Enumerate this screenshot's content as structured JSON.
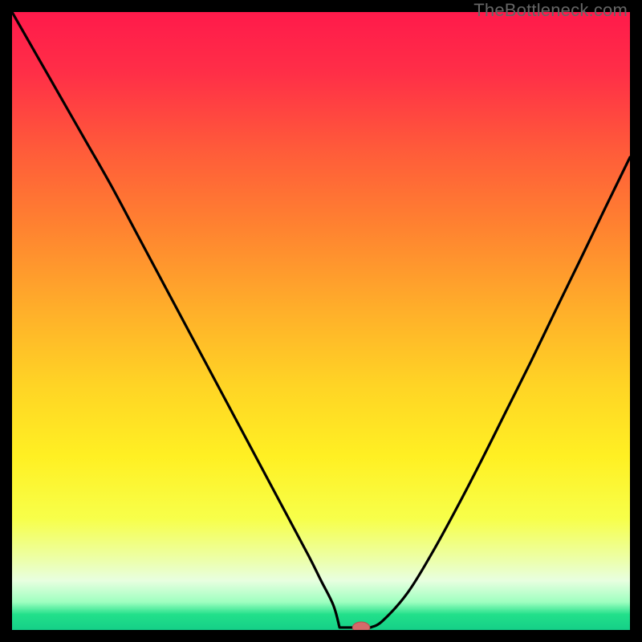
{
  "watermark": "TheBottleneck.com",
  "colors": {
    "frame": "#000000",
    "curve": "#000000",
    "marker_fill": "#d46a6a",
    "marker_stroke": "#b74f4f",
    "gradient_stops": [
      {
        "offset": 0.0,
        "color": "#ff1a4b"
      },
      {
        "offset": 0.1,
        "color": "#ff2f47"
      },
      {
        "offset": 0.22,
        "color": "#ff5a3a"
      },
      {
        "offset": 0.35,
        "color": "#ff8330"
      },
      {
        "offset": 0.48,
        "color": "#ffae2a"
      },
      {
        "offset": 0.6,
        "color": "#ffd325"
      },
      {
        "offset": 0.72,
        "color": "#fff023"
      },
      {
        "offset": 0.82,
        "color": "#f7ff4a"
      },
      {
        "offset": 0.88,
        "color": "#edffa0"
      },
      {
        "offset": 0.92,
        "color": "#e8ffe0"
      },
      {
        "offset": 0.955,
        "color": "#9effc0"
      },
      {
        "offset": 0.975,
        "color": "#22e08a"
      },
      {
        "offset": 1.0,
        "color": "#15cf88"
      }
    ]
  },
  "chart_data": {
    "type": "line",
    "title": "",
    "xlabel": "",
    "ylabel": "",
    "xlim": [
      0,
      100
    ],
    "ylim": [
      0,
      100
    ],
    "series": [
      {
        "name": "bottleneck-curve",
        "x": [
          0,
          4,
          8,
          12,
          16,
          20,
          24,
          28,
          32,
          36,
          40,
          44,
          48,
          50,
          52,
          54,
          56,
          57,
          58,
          60,
          64,
          68,
          72,
          76,
          80,
          84,
          88,
          92,
          96,
          100
        ],
        "y": [
          100,
          93,
          86,
          79,
          72,
          64.5,
          57,
          49.5,
          42,
          34.5,
          27,
          19.5,
          12,
          8,
          4,
          1.5,
          0.5,
          0.4,
          0.5,
          1.5,
          6,
          12.5,
          19.8,
          27.5,
          35.5,
          43.5,
          51.8,
          60,
          68.3,
          76.5
        ]
      }
    ],
    "flat_segment": {
      "x_start": 53,
      "x_end": 58,
      "y": 0.4
    },
    "marker": {
      "x": 56.5,
      "y": 0.4,
      "rx": 1.4,
      "ry": 0.9
    },
    "legend": null,
    "grid": false
  }
}
